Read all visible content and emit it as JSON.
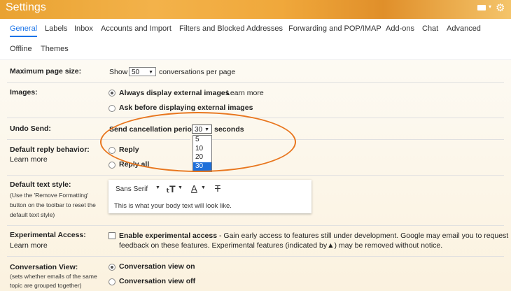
{
  "header": {
    "title": "Settings",
    "gear_glyph": "⚙",
    "caret_glyph": "▾"
  },
  "tabs": {
    "row1": [
      "General",
      "Labels",
      "Inbox",
      "Accounts and Import",
      "Filters and Blocked Addresses",
      "Forwarding and POP/IMAP",
      "Add-ons",
      "Chat",
      "Advanced"
    ],
    "row2": [
      "Offline",
      "Themes"
    ],
    "active": "General"
  },
  "settings": {
    "max_page": {
      "label": "Maximum page size:",
      "show": "Show",
      "value": "50",
      "suffix": "conversations per page"
    },
    "images": {
      "label": "Images:",
      "opt1": "Always display external images",
      "sep": " - ",
      "learn": "Learn more",
      "opt2": "Ask before displaying external images"
    },
    "undo": {
      "label": "Undo Send:",
      "period_label": "Send cancellation period:",
      "value": "30",
      "suffix": "seconds",
      "options": [
        "5",
        "10",
        "20",
        "30"
      ]
    },
    "reply": {
      "label": "Default reply behavior:",
      "learn": "Learn more",
      "opt1": "Reply",
      "opt2": "Reply all"
    },
    "text_style": {
      "label": "Default text style:",
      "hint1": "(Use the 'Remove Formatting'",
      "hint2": "button on the toolbar to reset the",
      "hint3": "default text style)",
      "font": "Sans Serif",
      "preview": "This is what your body text will look like."
    },
    "experimental": {
      "label": "Experimental Access:",
      "learn": "Learn more",
      "enable": "Enable experimental access",
      "desc1": " - Gain early access to features still under development. Google may email you to request",
      "desc2a": "feedback on these features. Experimental features (indicated by",
      "desc2b": ") may be removed without notice."
    },
    "conversation": {
      "label": "Conversation View:",
      "hint1": "(sets whether emails of the same",
      "hint2": "topic are grouped together)",
      "opt1": "Conversation view on",
      "opt2": "Conversation view off"
    }
  },
  "colors": {
    "accent": "#1a73e8",
    "highlight_ellipse": "#e8761e",
    "header_orange": "#f0a83b"
  }
}
